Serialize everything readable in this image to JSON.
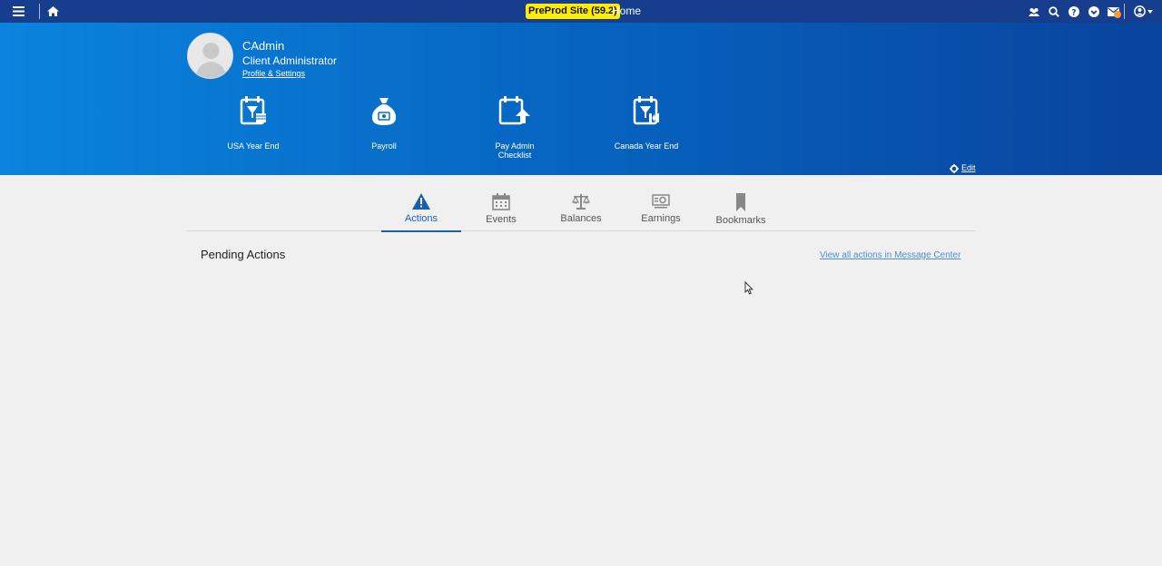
{
  "topbar": {
    "site_badge": "PreProd Site (59.2)",
    "page_title": "Home",
    "icons": [
      "menu-icon",
      "home-icon",
      "team-icon",
      "search-icon",
      "help-icon",
      "check-icon",
      "mail-icon",
      "user-icon",
      "caret-down-icon"
    ]
  },
  "profile": {
    "name": "CAdmin",
    "role": "Client Administrator",
    "settings_link": "Profile & Settings"
  },
  "quick_links": [
    {
      "label": "USA Year End",
      "icon": "calendar-flag-usa-icon"
    },
    {
      "label": "Payroll",
      "icon": "money-bag-icon"
    },
    {
      "label": "Pay Admin\nChecklist",
      "icon": "calendar-upload-icon"
    },
    {
      "label": "Canada Year End",
      "icon": "calendar-flag-canada-icon"
    }
  ],
  "edit_label": "Edit",
  "tabs": [
    {
      "label": "Actions",
      "icon": "warning-icon",
      "active": true
    },
    {
      "label": "Events",
      "icon": "calendar-icon",
      "active": false
    },
    {
      "label": "Balances",
      "icon": "scale-icon",
      "active": false
    },
    {
      "label": "Earnings",
      "icon": "money-icon",
      "active": false
    },
    {
      "label": "Bookmarks",
      "icon": "bookmark-icon",
      "active": false
    }
  ],
  "pending": {
    "title": "Pending Actions",
    "link": "View all actions in Message Center"
  },
  "colors": {
    "topbar": "#173e8c",
    "header_start": "#0a84de",
    "header_end": "#08439d",
    "badge": "#ffed00",
    "active_tab": "#1b5fb5",
    "link": "#4e8fd0"
  }
}
